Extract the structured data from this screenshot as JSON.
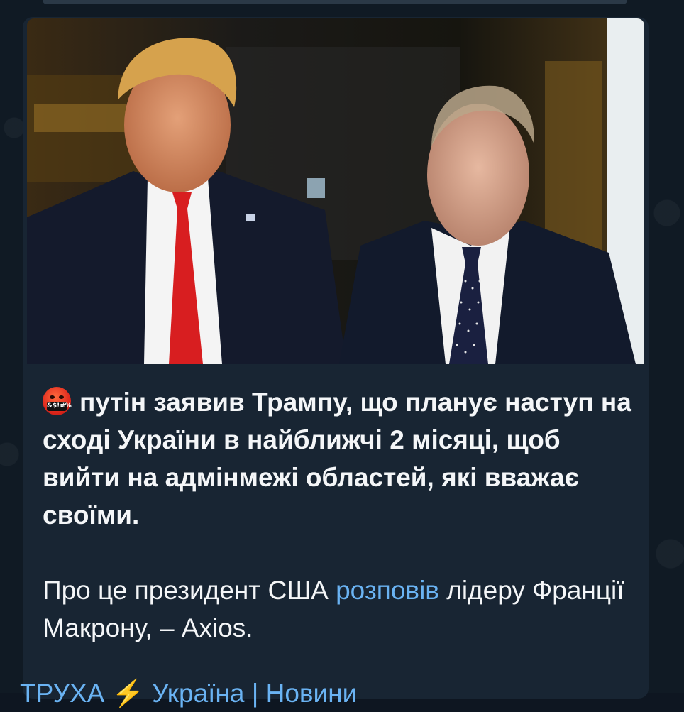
{
  "message": {
    "lead_emoji": "&$!#%",
    "lead_text": "путін заявив Трампу, що планує наступ на сході України в найближчі 2 місяці, щоб вийти на адмінмежі областей, які вважає своїми.",
    "second_prefix": "Про це президент США ",
    "second_link": "розповів",
    "second_suffix": " лідеру Франції Макрону, – Axios.",
    "footer_partial": "ТРУХА ⚡ Україна | Новини"
  },
  "colors": {
    "background": "#0e1621",
    "bubble": "#182533",
    "text": "#f4f6f8",
    "link": "#6ab3f3"
  }
}
